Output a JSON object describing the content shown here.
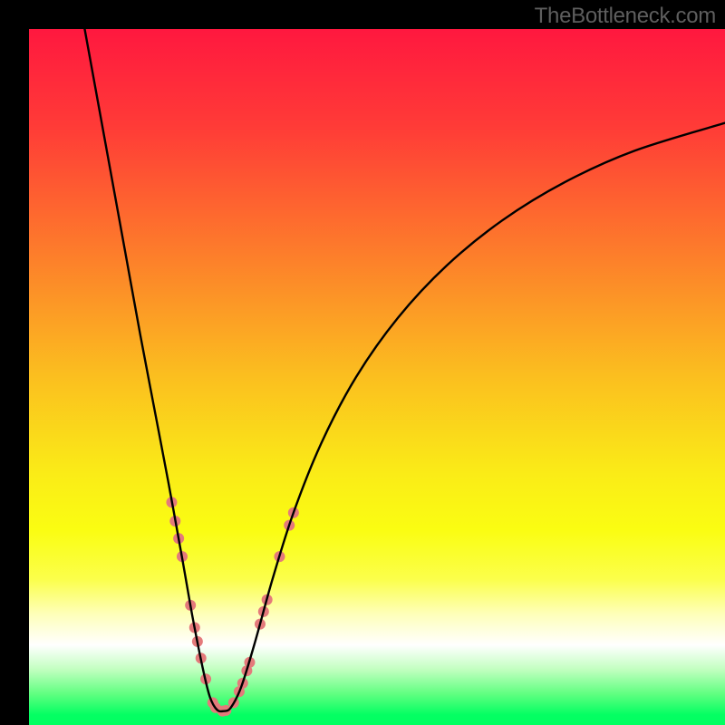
{
  "watermark": "TheBottleneck.com",
  "chart_data": {
    "type": "line",
    "title": "",
    "xlabel": "",
    "ylabel": "",
    "xlim": [
      0,
      100
    ],
    "ylim": [
      0,
      100
    ],
    "background_gradient": {
      "stops": [
        {
          "offset": 0.0,
          "color": "#ff183f"
        },
        {
          "offset": 0.14,
          "color": "#ff3b37"
        },
        {
          "offset": 0.32,
          "color": "#fd7c2b"
        },
        {
          "offset": 0.5,
          "color": "#fbbf1f"
        },
        {
          "offset": 0.64,
          "color": "#faec17"
        },
        {
          "offset": 0.72,
          "color": "#fafd12"
        },
        {
          "offset": 0.79,
          "color": "#fbff4a"
        },
        {
          "offset": 0.84,
          "color": "#feffb8"
        },
        {
          "offset": 0.885,
          "color": "#ffffff"
        },
        {
          "offset": 0.92,
          "color": "#c2ffc0"
        },
        {
          "offset": 0.955,
          "color": "#61ff81"
        },
        {
          "offset": 0.985,
          "color": "#05ff63"
        },
        {
          "offset": 1.0,
          "color": "#00ff61"
        }
      ]
    },
    "series": [
      {
        "name": "bottleneck-curve",
        "description": "V-shaped curve from top, dipping to baseline near x≈27, rising again",
        "points": [
          {
            "x": 8.0,
            "y": 100.0
          },
          {
            "x": 10.0,
            "y": 89.0
          },
          {
            "x": 12.0,
            "y": 78.0
          },
          {
            "x": 14.0,
            "y": 67.0
          },
          {
            "x": 16.0,
            "y": 56.0
          },
          {
            "x": 18.0,
            "y": 45.5
          },
          {
            "x": 20.0,
            "y": 35.0
          },
          {
            "x": 22.0,
            "y": 24.0
          },
          {
            "x": 23.5,
            "y": 15.5
          },
          {
            "x": 25.0,
            "y": 8.0
          },
          {
            "x": 26.0,
            "y": 4.0
          },
          {
            "x": 27.0,
            "y": 2.2
          },
          {
            "x": 28.0,
            "y": 2.0
          },
          {
            "x": 29.0,
            "y": 2.5
          },
          {
            "x": 30.5,
            "y": 5.5
          },
          {
            "x": 32.5,
            "y": 12.0
          },
          {
            "x": 35.0,
            "y": 21.0
          },
          {
            "x": 38.0,
            "y": 30.5
          },
          {
            "x": 42.0,
            "y": 40.5
          },
          {
            "x": 47.0,
            "y": 50.0
          },
          {
            "x": 53.0,
            "y": 58.5
          },
          {
            "x": 60.0,
            "y": 66.0
          },
          {
            "x": 68.0,
            "y": 72.5
          },
          {
            "x": 77.0,
            "y": 78.0
          },
          {
            "x": 87.0,
            "y": 82.5
          },
          {
            "x": 100.0,
            "y": 86.5
          }
        ]
      }
    ],
    "markers": {
      "name": "highlighted-points",
      "color": "#e47a7b",
      "note": "Faint pink dots sitting along the curve",
      "points": [
        {
          "x": 20.5,
          "y": 32.0,
          "r": 6
        },
        {
          "x": 21.0,
          "y": 29.3,
          "r": 6
        },
        {
          "x": 21.5,
          "y": 26.8,
          "r": 6
        },
        {
          "x": 22.0,
          "y": 24.2,
          "r": 6
        },
        {
          "x": 23.2,
          "y": 17.2,
          "r": 6
        },
        {
          "x": 23.8,
          "y": 14.0,
          "r": 6
        },
        {
          "x": 24.2,
          "y": 12.0,
          "r": 6
        },
        {
          "x": 24.7,
          "y": 9.6,
          "r": 6
        },
        {
          "x": 25.4,
          "y": 6.6,
          "r": 6
        },
        {
          "x": 26.4,
          "y": 3.2,
          "r": 6
        },
        {
          "x": 26.8,
          "y": 2.5,
          "r": 6
        },
        {
          "x": 27.8,
          "y": 2.0,
          "r": 6
        },
        {
          "x": 28.3,
          "y": 2.1,
          "r": 6
        },
        {
          "x": 29.4,
          "y": 3.2,
          "r": 6
        },
        {
          "x": 30.2,
          "y": 4.8,
          "r": 6
        },
        {
          "x": 30.7,
          "y": 6.0,
          "r": 6
        },
        {
          "x": 31.3,
          "y": 7.8,
          "r": 6
        },
        {
          "x": 31.7,
          "y": 9.0,
          "r": 6
        },
        {
          "x": 33.2,
          "y": 14.5,
          "r": 6
        },
        {
          "x": 33.7,
          "y": 16.3,
          "r": 6
        },
        {
          "x": 34.2,
          "y": 18.0,
          "r": 6
        },
        {
          "x": 36.0,
          "y": 24.2,
          "r": 6
        },
        {
          "x": 37.4,
          "y": 28.7,
          "r": 6
        },
        {
          "x": 38.0,
          "y": 30.5,
          "r": 6
        }
      ]
    }
  }
}
